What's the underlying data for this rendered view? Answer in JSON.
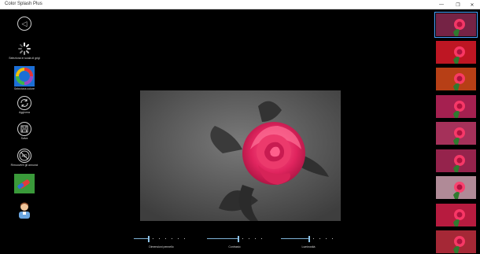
{
  "window": {
    "title": "Color Splash Plus",
    "controls": [
      "—",
      "❐",
      "✕"
    ]
  },
  "toolbar": {
    "back": "◁",
    "items": [
      {
        "label": "Seleziona in scala di grigi"
      },
      {
        "label": "Seleziona colore"
      },
      {
        "label": "Aggiorna"
      },
      {
        "label": "Salva"
      },
      {
        "label": "Rimuovere gli annunci"
      },
      {
        "label": ""
      },
      {
        "label": ""
      }
    ]
  },
  "sliders": [
    {
      "label": "Dimensioni pennello",
      "value": 0.25
    },
    {
      "label": "Contrasto",
      "value": 0.55
    },
    {
      "label": "Luminosità",
      "value": 0.5
    }
  ],
  "filters": {
    "count": 9,
    "selected_index": 0
  },
  "colors": {
    "accent": "#4aa3ff",
    "rose": "#e0245e",
    "background": "#000000"
  }
}
